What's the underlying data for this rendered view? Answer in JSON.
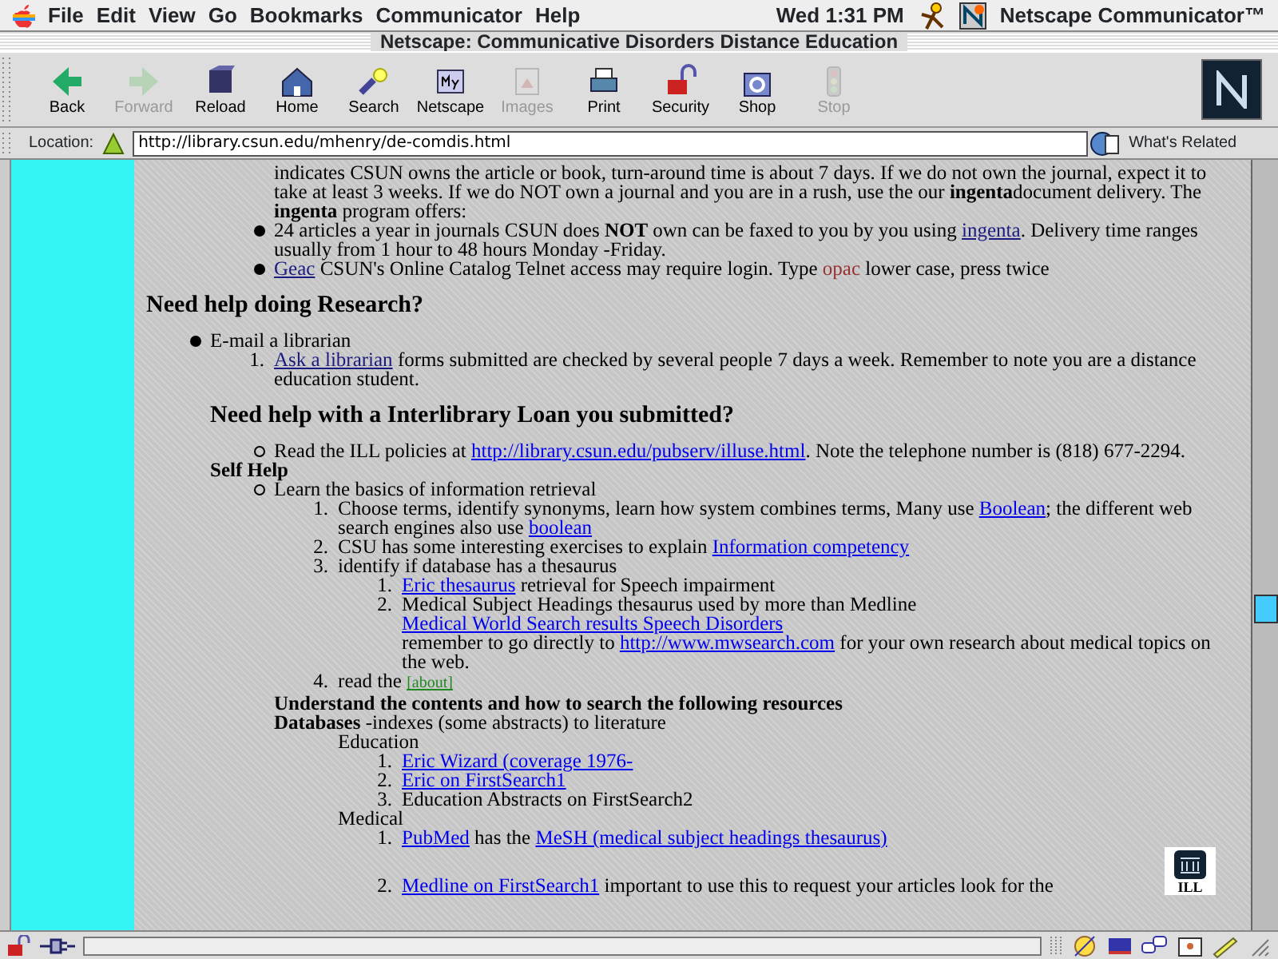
{
  "menu_bar": {
    "items": [
      "File",
      "Edit",
      "View",
      "Go",
      "Bookmarks",
      "Communicator",
      "Help"
    ],
    "clock": "Wed 1:31 PM",
    "app_name": "Netscape Communicator™"
  },
  "window": {
    "title": "Netscape: Communicative Disorders Distance Education"
  },
  "toolbar": [
    {
      "label": "Back",
      "disabled": false
    },
    {
      "label": "Forward",
      "disabled": true
    },
    {
      "label": "Reload",
      "disabled": false
    },
    {
      "label": "Home",
      "disabled": false
    },
    {
      "label": "Search",
      "disabled": false
    },
    {
      "label": "Netscape",
      "disabled": false
    },
    {
      "label": "Images",
      "disabled": true
    },
    {
      "label": "Print",
      "disabled": false
    },
    {
      "label": "Security",
      "disabled": false
    },
    {
      "label": "Shop",
      "disabled": false
    },
    {
      "label": "Stop",
      "disabled": true
    }
  ],
  "status_bar": {
    "progress": {
      "level": 0
    }
  },
  "location_bar": {
    "label": "Location:",
    "url": "http://library.csun.edu/mhenry/de-comdis.html",
    "related": "What's Related"
  },
  "content": [
    {
      "kind": "group",
      "children": [
        {
          "kind": "para",
          "segments": [
            {
              "kind": "text",
              "text": "indicates CSUN owns the article or book, turn-around time is about 7 days. If we do not own the journal, expect it to take at least 3 weeks. If we do NOT own a journal and you are in a rush, use the our **ingenta**document delivery. The **ingenta** program offers:"
            }
          ]
        },
        {
          "kind": "bullet",
          "segments": [
            {
              "kind": "text",
              "text": "24 articles a year in journals CSUN does **NOT** own can be faxed to you by you using "
            },
            {
              "kind": "visited",
              "text": "ingenta"
            },
            {
              "kind": "text",
              "text": ". Delivery time ranges usually from 1 hour to 48 hours Monday -Friday."
            }
          ]
        },
        {
          "kind": "bullet",
          "segments": [
            {
              "kind": "visited",
              "text": "Geac"
            },
            {
              "kind": "text",
              "text": " CSUN's Online Catalog Telnet access may require login. Type "
            },
            {
              "kind": "code",
              "text": "opac"
            },
            {
              "kind": "text",
              "text": " lower case, press twice"
            }
          ]
        }
      ]
    },
    {
      "kind": "heading",
      "segments": [
        {
          "kind": "text",
          "text": "Need help doing Research?"
        }
      ],
      "children": [
        {
          "kind": "bullet",
          "segments": [
            {
              "kind": "text",
              "text": "E-mail a librarian"
            }
          ],
          "children": [
            {
              "kind": "number",
              "marker": "1.",
              "segments": [
                {
                  "kind": "visited",
                  "text": "Ask a librarian"
                },
                {
                  "kind": "text",
                  "text": " forms submitted are checked by several people 7 days a week. Remember to note you are a distance education student."
                }
              ]
            }
          ]
        },
        {
          "kind": "heading",
          "segments": [
            {
              "kind": "text",
              "text": "Need help with a Interlibrary Loan you submitted?"
            }
          ],
          "children": [
            {
              "kind": "circle",
              "segments": [
                {
                  "kind": "text",
                  "text": "Read the ILL policies at "
                },
                {
                  "kind": "link",
                  "text": "http://library.csun.edu/pubserv/illuse.html"
                },
                {
                  "kind": "text",
                  "text": ". Note the telephone number is (818) 677-2294."
                }
              ]
            }
          ]
        },
        {
          "kind": "label",
          "segments": [
            {
              "kind": "text",
              "text": "Self Help"
            }
          ],
          "children": [
            {
              "kind": "circle",
              "segments": [
                {
                  "kind": "text",
                  "text": "Learn the basics of information retrieval"
                }
              ],
              "children": [
                {
                  "kind": "number",
                  "marker": "1.",
                  "segments": [
                    {
                      "kind": "text",
                      "text": "Choose terms, identify synonyms, learn how system combines terms, Many use "
                    },
                    {
                      "kind": "link",
                      "text": "Boolean"
                    },
                    {
                      "kind": "text",
                      "text": "; the different web search engines also use "
                    },
                    {
                      "kind": "link",
                      "text": "boolean"
                    }
                  ]
                },
                {
                  "kind": "number",
                  "marker": "2.",
                  "segments": [
                    {
                      "kind": "text",
                      "text": "CSU has some interesting exercises to explain "
                    },
                    {
                      "kind": "link",
                      "text": "Information competency"
                    }
                  ]
                },
                {
                  "kind": "number",
                  "marker": "3.",
                  "segments": [
                    {
                      "kind": "text",
                      "text": "identify if database has a thesaurus"
                    }
                  ],
                  "children": [
                    {
                      "kind": "number",
                      "marker": "1.",
                      "segments": [
                        {
                          "kind": "link",
                          "text": "Eric thesaurus"
                        },
                        {
                          "kind": "text",
                          "text": " retrieval for Speech impairment"
                        }
                      ]
                    },
                    {
                      "kind": "number",
                      "marker": "2.",
                      "segments": [
                        {
                          "kind": "text",
                          "text": "Medical Subject Headings thesaurus used by more than Medline"
                        },
                        {
                          "kind": "break"
                        },
                        {
                          "kind": "link",
                          "text": "Medical World Search results Speech Disorders"
                        },
                        {
                          "kind": "break"
                        },
                        {
                          "kind": "text",
                          "text": "remember to go directly to "
                        },
                        {
                          "kind": "link",
                          "text": "http://www.mwsearch.com"
                        },
                        {
                          "kind": "text",
                          "text": " for your own research about medical topics on the web."
                        }
                      ]
                    }
                  ]
                },
                {
                  "kind": "number",
                  "marker": "4.",
                  "segments": [
                    {
                      "kind": "text",
                      "text": "read the "
                    },
                    {
                      "kind": "small",
                      "text": "[about]"
                    }
                  ]
                }
              ]
            },
            {
              "kind": "label",
              "segments": [
                {
                  "kind": "text",
                  "text": "Understand the contents and how to search the following resources"
                }
              ]
            },
            {
              "kind": "para",
              "segments": [
                {
                  "kind": "text",
                  "text": "**Databases** -indexes (some abstracts) to literature"
                }
              ],
              "children": [
                {
                  "kind": "para",
                  "segments": [
                    {
                      "kind": "text",
                      "text": "Education"
                    }
                  ],
                  "children": [
                    {
                      "kind": "number",
                      "marker": "1.",
                      "segments": [
                        {
                          "kind": "link",
                          "text": "Eric Wizard (coverage 1976-"
                        }
                      ]
                    },
                    {
                      "kind": "number",
                      "marker": "2.",
                      "segments": [
                        {
                          "kind": "link",
                          "text": "Eric on FirstSearch1"
                        }
                      ]
                    },
                    {
                      "kind": "number",
                      "marker": "3.",
                      "segments": [
                        {
                          "kind": "text",
                          "text": "Education Abstracts on FirstSearch2"
                        }
                      ]
                    }
                  ]
                },
                {
                  "kind": "para",
                  "segments": [
                    {
                      "kind": "text",
                      "text": "Medical"
                    }
                  ],
                  "children": [
                    {
                      "kind": "number",
                      "marker": "1.",
                      "segments": [
                        {
                          "kind": "link",
                          "text": "PubMed"
                        },
                        {
                          "kind": "text",
                          "text": " has the "
                        },
                        {
                          "kind": "link",
                          "text": "MeSH (medical subject headings thesaurus)"
                        }
                      ]
                    },
                    {
                      "kind": "number",
                      "marker": "2.",
                      "badge": "ILL",
                      "segments": [
                        {
                          "kind": "link",
                          "text": "Medline on FirstSearch1"
                        },
                        {
                          "kind": "text",
                          "text": " important to use this to request your articles look for the"
                        }
                      ]
                    }
                  ]
                }
              ]
            }
          ]
        }
      ]
    }
  ]
}
